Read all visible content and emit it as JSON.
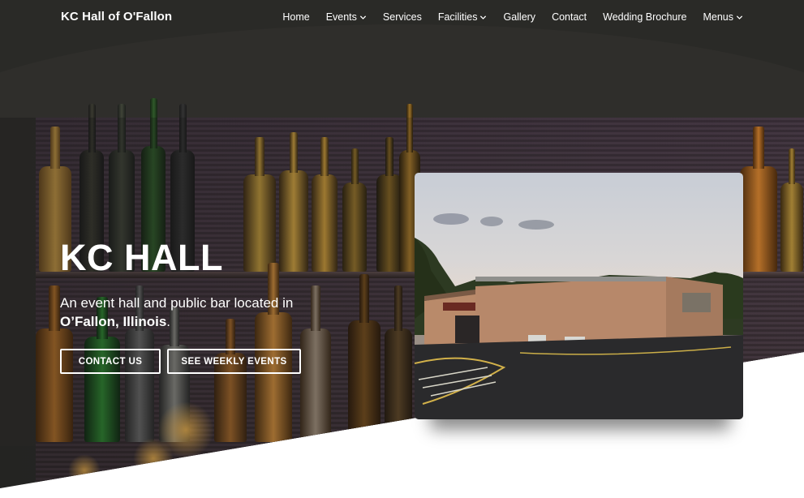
{
  "nav": {
    "brand": "KC Hall of O'Fallon",
    "items": [
      {
        "label": "Home",
        "has_dropdown": false
      },
      {
        "label": "Events",
        "has_dropdown": true
      },
      {
        "label": "Services",
        "has_dropdown": false
      },
      {
        "label": "Facilities",
        "has_dropdown": true
      },
      {
        "label": "Gallery",
        "has_dropdown": false
      },
      {
        "label": "Contact",
        "has_dropdown": false
      },
      {
        "label": "Wedding Brochure",
        "has_dropdown": false
      },
      {
        "label": "Menus",
        "has_dropdown": true
      }
    ]
  },
  "hero": {
    "title": "KC HALL",
    "subtitle_prefix": "An event hall and public bar located in",
    "subtitle_location": "O’Fallon, Illinois",
    "subtitle_suffix": ".",
    "buttons": {
      "contact": "CONTACT US",
      "events": "SEE WEEKLY EVENTS"
    }
  },
  "colors": {
    "text": "#ffffff",
    "background": "#2c2c2a",
    "page": "#ffffff"
  }
}
